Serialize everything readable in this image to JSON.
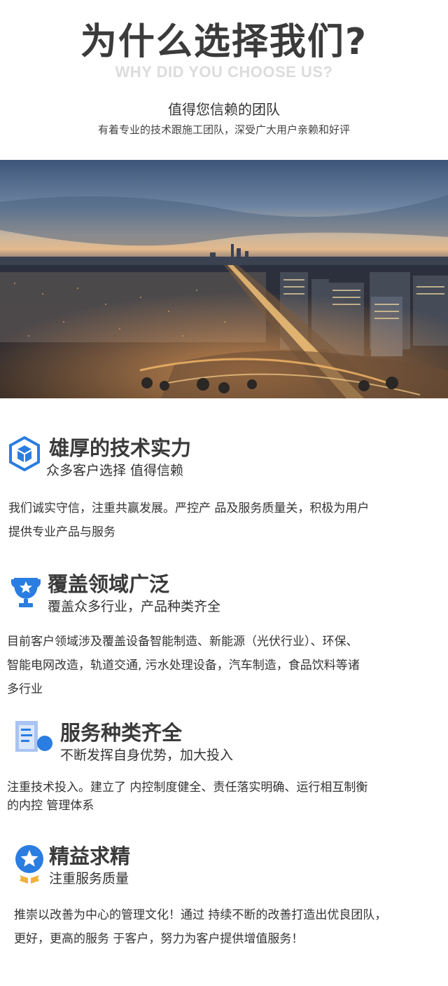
{
  "header": {
    "title": "为什么选择我们?",
    "subtitle_en": "WHY DID YOU CHOOSE US?",
    "tagline": "值得您信赖的团队",
    "description": "有着专业的技术跟施工团队，深受广大用户亲赖和好评"
  },
  "features": [
    {
      "icon": "cube-hexagon-icon",
      "title": "雄厚的技术实力",
      "subtitle": "众多客户选择 值得信赖",
      "body_lines": [
        "我们诚实守信，注重共赢发展。严控产 品及服务质量关，积极为用户",
        "提供专业产品与服务"
      ]
    },
    {
      "icon": "trophy-star-icon",
      "title": "覆盖领域广泛",
      "subtitle": "覆盖众多行业，产品种类齐全",
      "body_lines": [
        "目前客户领域涉及覆盖设备智能制造、新能源（光伏行业）、环保、",
        "智能电网改造，轨道交通, 污水处理设备，汽车制造，食品饮料等诸",
        "多行业"
      ]
    },
    {
      "icon": "document-list-icon",
      "title": "服务种类齐全",
      "subtitle": "不断发挥自身优势，加大投入",
      "body_lines": [
        "注重技术投入。建立了 内控制度健全、责任落实明确、运行相互制衡",
        "的内控 管理体系"
      ]
    },
    {
      "icon": "star-medal-icon",
      "title": "精益求精",
      "subtitle": "注重服务质量",
      "body_lines": [
        "推崇以改善为中心的管理文化！通过 持续不断的改善打造出优良团队，",
        "更好，更高的服务 于客户，努力为客户提供增值服务！"
      ]
    }
  ],
  "colors": {
    "icon_blue": "#2a7de1",
    "icon_blue_light": "#8fb6f2",
    "medal_gold": "#f2b23a",
    "title_dark": "#3a3a3a",
    "subtitle_gray": "#dcdcdc"
  }
}
